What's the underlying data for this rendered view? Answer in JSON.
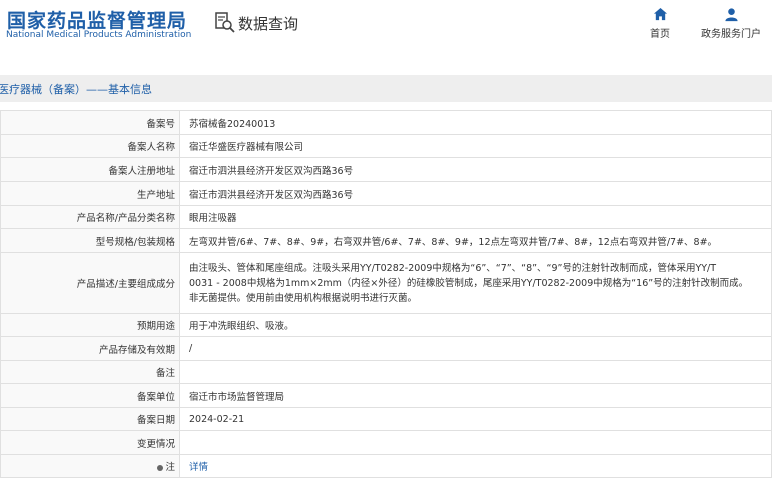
{
  "header": {
    "logo_cn": "国家药品监督管理局",
    "logo_en": "National Medical Products Administration",
    "query_label": "数据查询",
    "nav_home": "首页",
    "nav_gov": "政务服务门户"
  },
  "section_title": "医疗器械（备案）——基本信息",
  "fields": [
    {
      "key": "备案号",
      "value": "苏宿械备20240013"
    },
    {
      "key": "备案人名称",
      "value": "宿迁华盛医疗器械有限公司"
    },
    {
      "key": "备案人注册地址",
      "value": "宿迁市泗洪县经济开发区双沟西路36号"
    },
    {
      "key": "生产地址",
      "value": "宿迁市泗洪县经济开发区双沟西路36号"
    },
    {
      "key": "产品名称/产品分类名称",
      "value": "眼用注吸器"
    },
    {
      "key": "型号规格/包装规格",
      "value": "左弯双井管/6#、7#、8#、9#，右弯双井管/6#、7#、8#、9#，12点左弯双井管/7#、8#，12点右弯双井管/7#、8#。"
    },
    {
      "key": "产品描述/主要组成成分",
      "value_lines": [
        "由注吸头、管体和尾座组成。注吸头采用YY/T0282-2009中规格为“6”、“7”、“8”、“9”号的注射针改制而成，管体采用YY/T",
        "0031 - 2008中规格为1mm×2mm（内径×外径）的硅橡胶管制成，尾座采用YY/T0282-2009中规格为“16”号的注射针改制而成。",
        "非无菌提供。使用前由使用机构根据说明书进行灭菌。"
      ]
    },
    {
      "key": "预期用途",
      "value": "用于冲洗眼组织、吸液。"
    },
    {
      "key": "产品存储及有效期",
      "value": "/"
    },
    {
      "key": "备注",
      "value": ""
    },
    {
      "key": "备案单位",
      "value": "宿迁市市场监督管理局"
    },
    {
      "key": "备案日期",
      "value": "2024-02-21"
    },
    {
      "key": "变更情况",
      "value": ""
    },
    {
      "key": "注",
      "value": "详情"
    }
  ],
  "colors": {
    "brand": "#1f5fa8",
    "bar_bg": "#eeeeee",
    "border": "#e0e0e0"
  },
  "icons": {
    "query": "search-document-icon",
    "home": "home-icon",
    "gov": "user-icon",
    "note": "bulb-icon"
  }
}
